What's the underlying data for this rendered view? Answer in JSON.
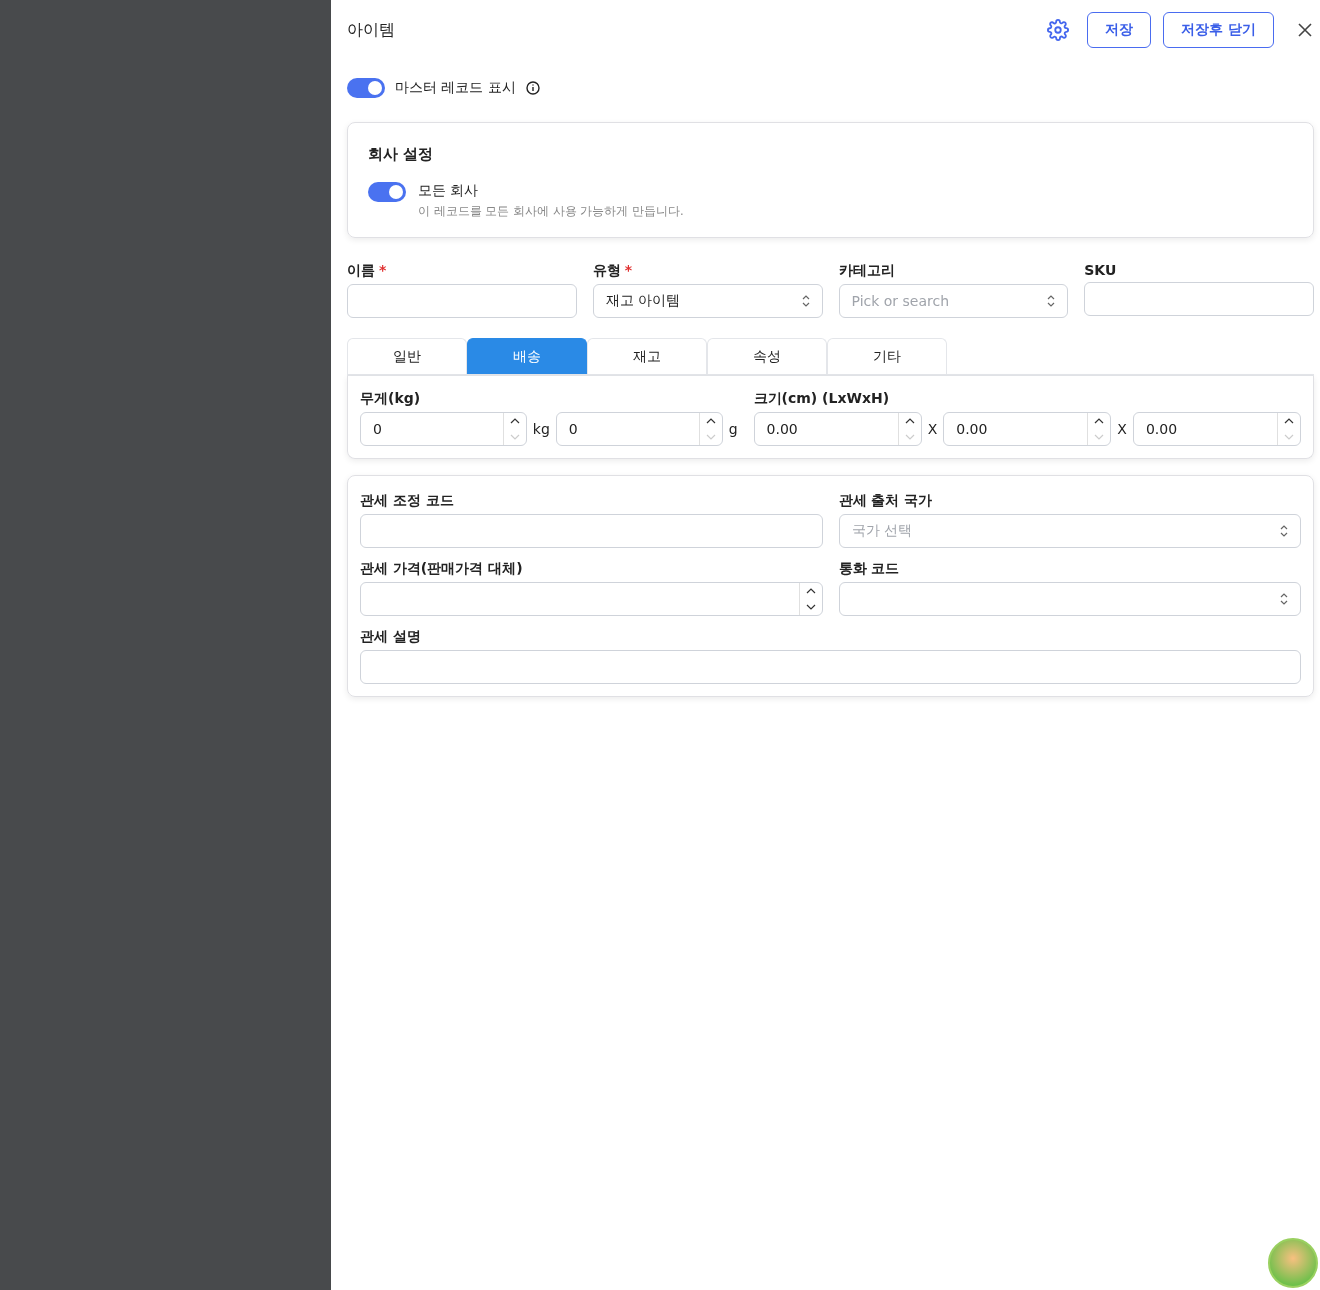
{
  "drawer": {
    "title": "아이템",
    "buttons": [
      {
        "label": "저장"
      },
      {
        "label": "저장후 닫기"
      }
    ]
  },
  "master_toggle": {
    "label": "마스터 레코드 표시",
    "on": true
  },
  "company_settings": {
    "title": "회사 설정",
    "toggle": {
      "label": "모든 회사",
      "on": true,
      "description": "이 레코드를 모든 회사에 사용 가능하게 만듭니다."
    }
  },
  "fields": [
    {
      "label": "이름",
      "required_mark": "*",
      "kind": "text"
    },
    {
      "label": "유형",
      "required_mark": "*",
      "kind": "select",
      "value": "재고 아이템"
    },
    {
      "label": "카테고리",
      "kind": "select",
      "placeholder": "Pick or search"
    },
    {
      "label": "SKU",
      "kind": "text"
    }
  ],
  "tabs": [
    {
      "label": "일반",
      "selected": false
    },
    {
      "label": "배송",
      "selected": true
    },
    {
      "label": "재고",
      "selected": false
    },
    {
      "label": "속성",
      "selected": false
    },
    {
      "label": "기타",
      "selected": false
    }
  ],
  "shipping": {
    "weight": {
      "label": "무게(kg)",
      "inputs": [
        {
          "value": "0",
          "unit": "kg"
        },
        {
          "value": "0",
          "unit": "g"
        }
      ]
    },
    "size": {
      "label": "크기(cm) (LxWxH)",
      "inputs": [
        {
          "value": "0.00"
        },
        {
          "separator": "X",
          "value": "0.00"
        },
        {
          "separator": "X",
          "value": "0.00"
        }
      ]
    }
  },
  "customs": [
    {
      "label": "관세 조정 코드",
      "kind": "text"
    },
    {
      "label": "관세 출처 국가",
      "kind": "select",
      "placeholder": "국가 선택"
    },
    {
      "label": "관세 가격(판매가격 대체)",
      "kind": "number"
    },
    {
      "label": "통화 코드",
      "kind": "select"
    },
    {
      "label": "관세 설명",
      "kind": "wide"
    }
  ]
}
